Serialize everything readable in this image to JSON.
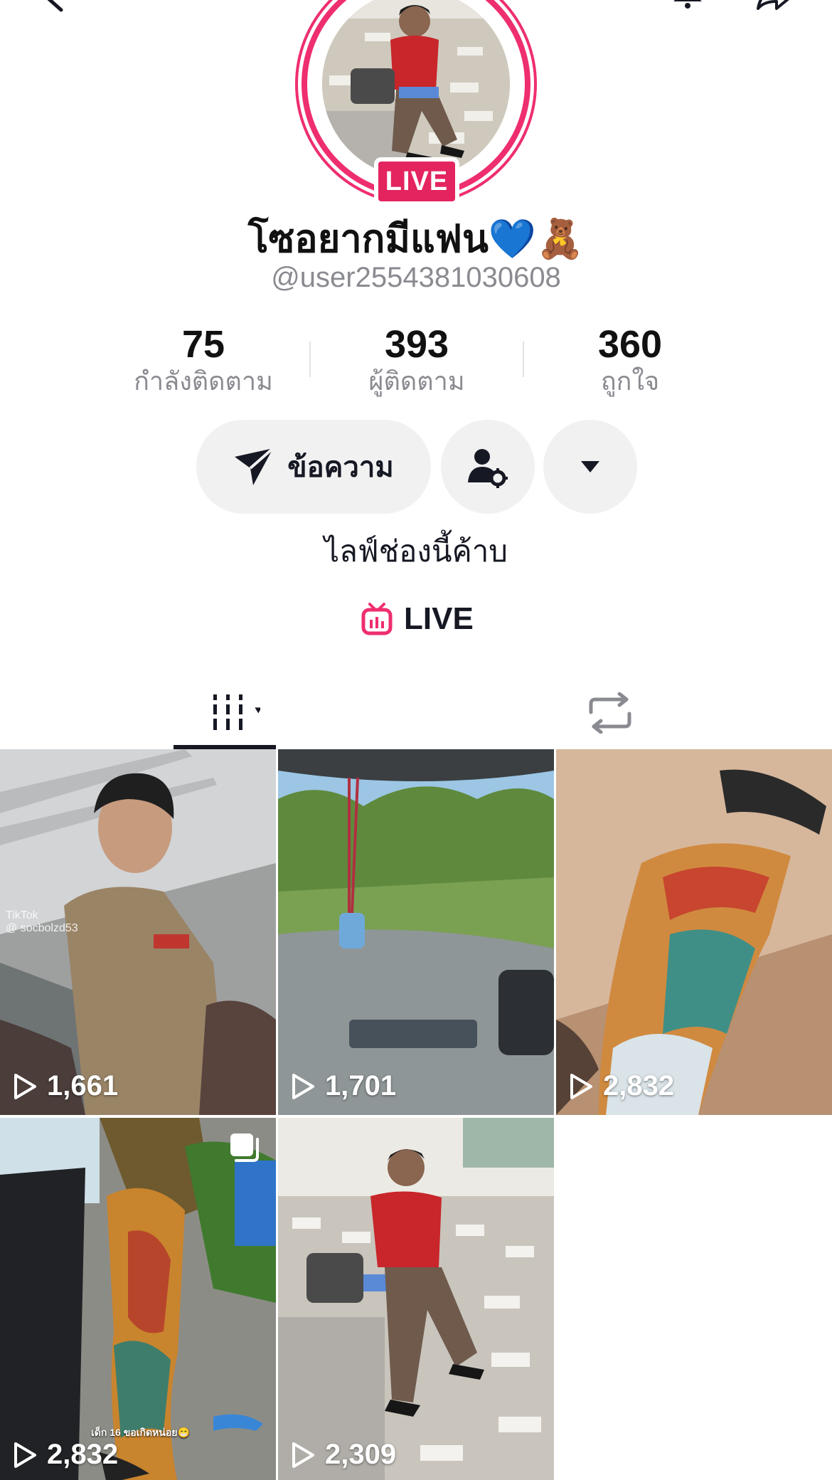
{
  "profile": {
    "display_name": "โซอยากมีแฟน💙🧸",
    "username": "@user2554381030608",
    "live_badge": "LIVE",
    "bio": "ไลฟ์ช่องนี้ค้าบ"
  },
  "stats": [
    {
      "value": "75",
      "label": "กำลังติดตาม"
    },
    {
      "value": "393",
      "label": "ผู้ติดตาม"
    },
    {
      "value": "360",
      "label": "ถูกใจ"
    }
  ],
  "actions": {
    "message_label": "ข้อความ"
  },
  "live_link": {
    "label": "LIVE"
  },
  "colors": {
    "accent": "#ee2e6f",
    "live_badge": "#e3245f",
    "button_bg": "#f1f1f2",
    "text_primary": "#161823",
    "text_secondary": "#8a8b91"
  },
  "tabs": [
    {
      "icon": "videos-grid-icon",
      "active": true
    },
    {
      "icon": "repost-icon",
      "active": false
    }
  ],
  "videos": [
    {
      "views": "1,661",
      "watermark": "TikTok\n@ socbolzd53",
      "multi": false
    },
    {
      "views": "1,701",
      "multi": false
    },
    {
      "views": "2,832",
      "multi": false
    },
    {
      "views": "2,832",
      "caption": "เด็ก 16 ขอเกิดหน่อย😁",
      "multi": true
    },
    {
      "views": "2,309",
      "multi": false
    }
  ]
}
